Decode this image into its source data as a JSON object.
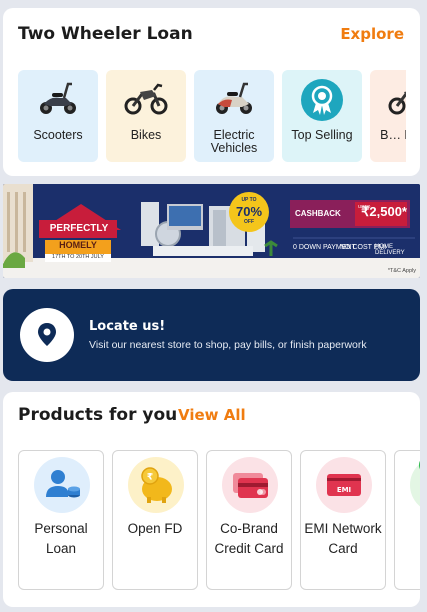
{
  "two_wheeler": {
    "title": "Two Wheeler Loan",
    "explore": "Explore",
    "categories": [
      {
        "label": "Scooters",
        "icon": "scooter-icon"
      },
      {
        "label": "Bikes",
        "icon": "bike-icon"
      },
      {
        "label": "Electric Vehicles",
        "icon": "electric-scooter-icon"
      },
      {
        "label": "Top Selling",
        "icon": "award-badge-icon"
      },
      {
        "label": "B… Mile…",
        "icon": "bike-icon"
      }
    ]
  },
  "banner": {
    "tag1": "PERFECTLY",
    "tag2": "HOMELY",
    "dates": "17TH TO 20TH JULY",
    "offer_top": "UP TO",
    "offer_pct": "70%",
    "offer_bottom": "OFF",
    "cashback_label": "CASHBACK",
    "cashback_upto": "UPTO",
    "cashback_amount": "₹2,500*",
    "feat1": "0 DOWN PAYMENT",
    "feat2": "NO COST EMI",
    "feat3": "HOME DELIVERY",
    "tnc": "*T&C Apply"
  },
  "locate": {
    "title": "Locate us!",
    "subtitle": "Visit our nearest store to shop, pay bills, or finish paperwork"
  },
  "products": {
    "title": "Products for you",
    "view_all": "View All",
    "items": [
      {
        "label": "Personal Loan",
        "icon": "personal-loan-icon"
      },
      {
        "label": "Open FD",
        "icon": "piggy-bank-icon"
      },
      {
        "label": "Co-Brand Credit Card",
        "icon": "credit-card-icon"
      },
      {
        "label": "EMI Network Card",
        "icon": "emi-card-icon"
      }
    ]
  },
  "colors": {
    "accent": "#f07c10",
    "locate_bg": "#0e2b57",
    "banner_bg": "#1b2f6b"
  }
}
